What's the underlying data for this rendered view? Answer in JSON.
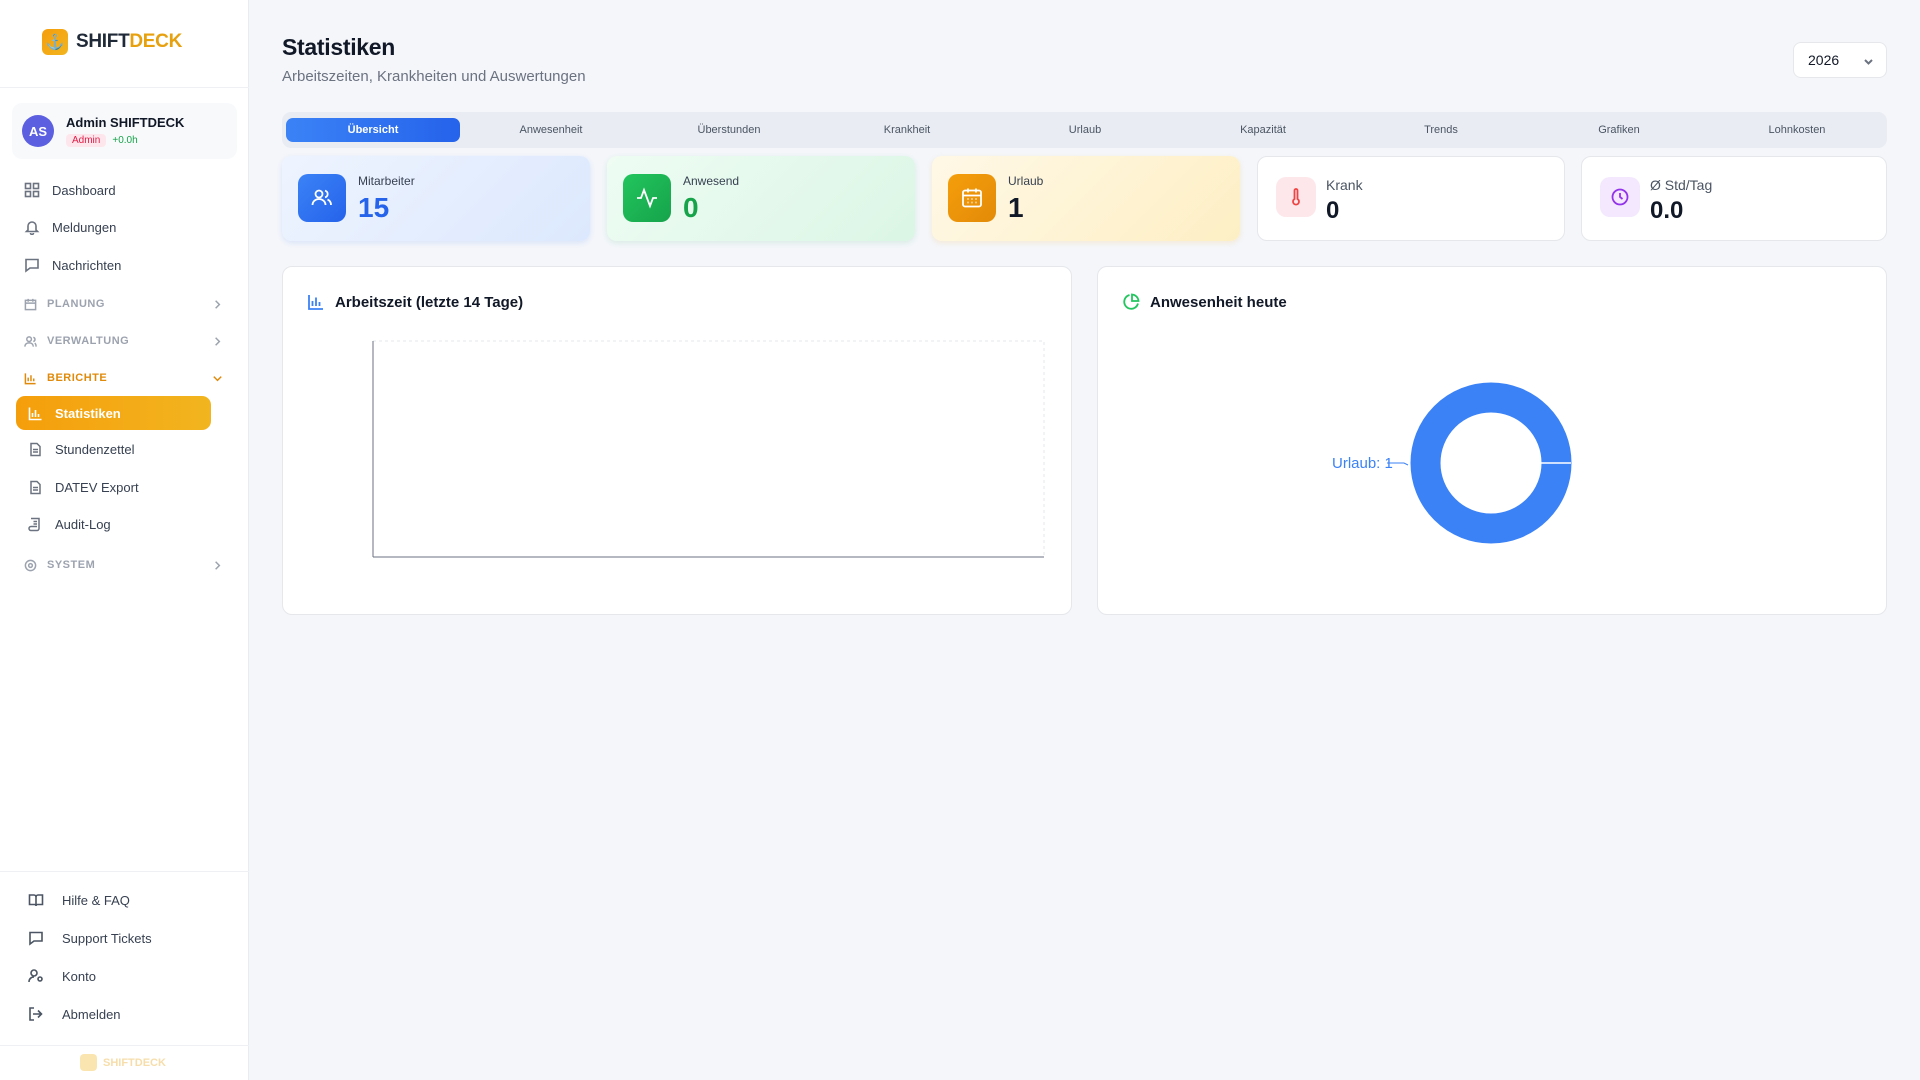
{
  "brand": {
    "name_a": "SHIFT",
    "name_b": "DECK",
    "footer": "SHIFTDECK"
  },
  "user": {
    "initials": "AS",
    "name": "Admin SHIFTDECK",
    "role": "Admin",
    "hours": "+0.0h"
  },
  "nav": {
    "dashboard": "Dashboard",
    "meldungen": "Meldungen",
    "nachrichten": "Nachrichten",
    "planung": "PLANUNG",
    "verwaltung": "VERWALTUNG",
    "berichte": "BERICHTE",
    "statistiken": "Statistiken",
    "stundenzettel": "Stundenzettel",
    "datev": "DATEV Export",
    "audit": "Audit-Log",
    "system": "SYSTEM"
  },
  "footer_nav": {
    "hilfe": "Hilfe & FAQ",
    "support": "Support Tickets",
    "konto": "Konto",
    "abmelden": "Abmelden"
  },
  "header": {
    "title": "Statistiken",
    "subtitle": "Arbeitszeiten, Krankheiten und Auswertungen",
    "year": "2026"
  },
  "tabs": [
    "Übersicht",
    "Anwesenheit",
    "Überstunden",
    "Krankheit",
    "Urlaub",
    "Kapazität",
    "Trends",
    "Grafiken",
    "Lohnkosten"
  ],
  "stats": {
    "mitarbeiter": {
      "label": "Mitarbeiter",
      "value": "15",
      "color": "#2563eb"
    },
    "anwesend": {
      "label": "Anwesend",
      "value": "0",
      "color": "#16a34a"
    },
    "urlaub": {
      "label": "Urlaub",
      "value": "1",
      "color": "#111827"
    },
    "krank": {
      "label": "Krank",
      "value": "0"
    },
    "std": {
      "label": "Ø Std/Tag",
      "value": "0.0"
    }
  },
  "panels": {
    "arbeitszeit": "Arbeitszeit (letzte 14 Tage)",
    "anwesenheit": "Anwesenheit heute"
  },
  "chart_data": [
    {
      "type": "bar",
      "title": "Arbeitszeit (letzte 14 Tage)",
      "categories": [],
      "values": []
    },
    {
      "type": "pie",
      "title": "Anwesenheit heute",
      "slices": [
        {
          "label": "Urlaub",
          "value": 1,
          "color": "#3b82f6"
        }
      ],
      "slice_label": "Urlaub: 1"
    }
  ]
}
